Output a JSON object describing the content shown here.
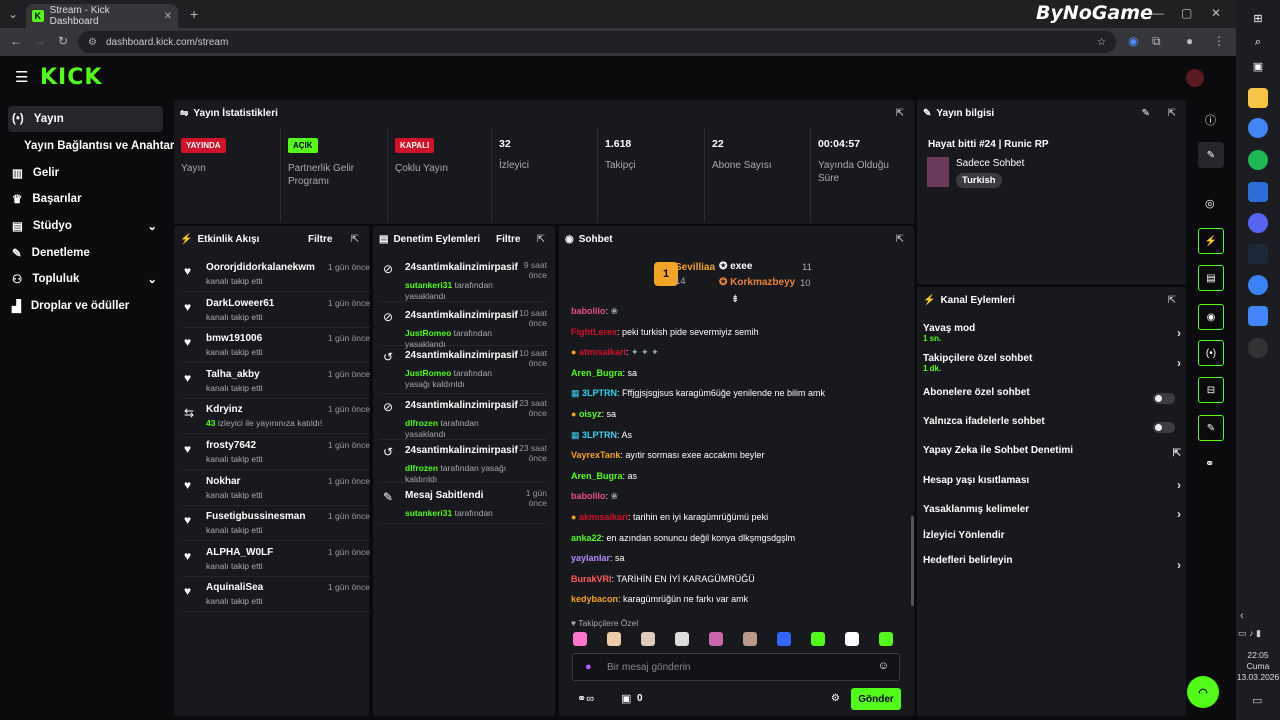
{
  "browser": {
    "tab_title": "Stream - Kick Dashboard",
    "url": "dashboard.kick.com/stream",
    "watermark": "ByNoGame"
  },
  "sidebar": {
    "items": [
      {
        "label": "Yayın",
        "icon": "broadcast-icon"
      },
      {
        "label": "Yayın Bağlantısı ve Anahtarı",
        "icon": ""
      },
      {
        "label": "Gelir",
        "icon": "chart-icon"
      },
      {
        "label": "Başarılar",
        "icon": "trophy-icon"
      },
      {
        "label": "Stüdyo",
        "icon": "studio-icon"
      },
      {
        "label": "Denetleme",
        "icon": "wrench-icon"
      },
      {
        "label": "Topluluk",
        "icon": "community-icon"
      },
      {
        "label": "Droplar ve ödüller",
        "icon": "drops-icon"
      }
    ]
  },
  "stats": {
    "title": "Yayın İstatistikleri",
    "items": [
      {
        "badge": "YAYINDA",
        "badge_color": "#d1102a",
        "label": "Yayın"
      },
      {
        "badge": "AÇIK",
        "badge_color": "#53fc18",
        "label": "Partnerlik Gelir Programı"
      },
      {
        "badge": "KAPALI",
        "badge_color": "#d1102a",
        "label": "Çoklu Yayın"
      },
      {
        "value": "32",
        "label": "İzleyici"
      },
      {
        "value": "1.618",
        "label": "Takipçi"
      },
      {
        "value": "22",
        "label": "Abone Sayısı"
      },
      {
        "value": "00:04:57",
        "label": "Yayında Olduğu Süre"
      }
    ]
  },
  "info": {
    "title": "Yayın bilgisi",
    "stream_title": "Hayat bitti #24 | Runic RP",
    "category": "Sadece Sohbet",
    "tag": "Turkish"
  },
  "activity": {
    "title": "Etkinlik Akışı",
    "filter": "Filtre",
    "items": [
      {
        "name": "Oororjdidorkalanekwm",
        "sub": "kanalı takip etti",
        "time": "1 gün önce"
      },
      {
        "name": "DarkLoweer61",
        "sub": "kanalı takip etti",
        "time": "1 gün önce"
      },
      {
        "name": "bmw191006",
        "sub": "kanalı takip etti",
        "time": "1 gün önce"
      },
      {
        "name": "Talha_akby",
        "sub": "kanalı takip etti",
        "time": "1 gün önce"
      },
      {
        "name": "Kdryinz",
        "sub_count": "43",
        "sub": "izleyici ile yayınınıza katıldı!",
        "time": "1 gün önce"
      },
      {
        "name": "frosty7642",
        "sub": "kanalı takip etti",
        "time": "1 gün önce"
      },
      {
        "name": "Nokhar",
        "sub": "kanalı takip etti",
        "time": "1 gün önce"
      },
      {
        "name": "Fusetigbussinesman",
        "sub": "kanalı takip etti",
        "time": "1 gün önce"
      },
      {
        "name": "ALPHA_W0LF",
        "sub": "kanalı takip etti",
        "time": "1 gün önce"
      },
      {
        "name": "AquinaliSea",
        "sub": "kanalı takip etti",
        "time": "1 gün önce"
      }
    ]
  },
  "moderation": {
    "title": "Denetim Eylemleri",
    "filter": "Filtre",
    "items": [
      {
        "name": "24santimkalinzimirpasif",
        "by": "sutankeri31",
        "sub": "tarafından yasaklandı",
        "time": "9 saat önce"
      },
      {
        "name": "24santimkalinzimirpasif",
        "by": "JustRomeo",
        "sub": "tarafından yasaklandı",
        "time": "10 saat önce"
      },
      {
        "name": "24santimkalinzimirpasif",
        "by": "JustRomeo",
        "sub": "tarafından yasağı kaldırıldı",
        "time": "10 saat önce"
      },
      {
        "name": "24santimkalinzimirpasif",
        "by": "dlfrozen",
        "sub": "tarafından yasaklandı",
        "time": "23 saat önce"
      },
      {
        "name": "24santimkalinzimirpasif",
        "by": "dlfrozen",
        "sub": "tarafından yasağı kaldırıldı",
        "time": "23 saat önce"
      },
      {
        "name": "Mesaj Sabitlendi",
        "by": "sutankeri31",
        "sub": "tarafından",
        "time": "1 gün önce"
      }
    ]
  },
  "chat": {
    "title": "Sohbet",
    "leaders": [
      {
        "name": "Sevilliaa",
        "count": "14"
      },
      {
        "name": "exee",
        "count": "11"
      },
      {
        "name": "Korkmazbeyy",
        "count": "10"
      }
    ],
    "messages": [
      {
        "user": "babolilo",
        "color": "#e64b8b",
        "text": ""
      },
      {
        "user": "FightLerex",
        "color": "#d1102a",
        "text": "peki turkish pide severmiyiz semih"
      },
      {
        "user": "atmısaikari",
        "color": "#d1102a",
        "text": "",
        "badge": true
      },
      {
        "user": "Aren_Bugra",
        "color": "#53fc18",
        "text": "sa"
      },
      {
        "user": "3LPTRN",
        "color": "#3ad0f0",
        "text": "Fffjgjsjsgjsus karagüm6üğe yenilende ne bilim amk"
      },
      {
        "user": "oisyz",
        "color": "#53fc18",
        "text": "sa",
        "badge": true
      },
      {
        "user": "3LPTRN",
        "color": "#3ad0f0",
        "text": "As"
      },
      {
        "user": "VayrexTank",
        "color": "#f7a324",
        "text": "ayıtir sorması exee accakmı beyler"
      },
      {
        "user": "Aren_Bugra",
        "color": "#53fc18",
        "text": "as"
      },
      {
        "user": "babolilo",
        "color": "#e64b8b",
        "text": ""
      },
      {
        "user": "akmısaikari",
        "color": "#d1102a",
        "text": "tarihin en iyi karagümrüğümü peki",
        "badge": true
      },
      {
        "user": "anka22",
        "color": "#53fc18",
        "text": "en azından sonuncu değil konya dlkşmgsdgşlm"
      },
      {
        "user": "yaylanlar",
        "color": "#b58bff",
        "text": "sa"
      },
      {
        "user": "BurakVRI",
        "color": "#ff5a5a",
        "text": "TARİHİN EN İYİ KARAGÜMRÜĞÜ"
      },
      {
        "user": "kedybacon",
        "color": "#f7a324",
        "text": "karagümrüğün ne farkı var amk"
      }
    ],
    "emote_label": "Takipçilere Özel",
    "placeholder": "Bir mesaj gönderin",
    "points": "0",
    "send": "Gönder"
  },
  "channel_actions": {
    "title": "Kanal Eylemleri",
    "items": [
      {
        "label": "Yavaş mod",
        "sub": "1 sn.",
        "control": "chevron"
      },
      {
        "label": "Takipçilere özel sohbet",
        "sub": "1 dk.",
        "control": "chevron"
      },
      {
        "label": "Abonelere özel sohbet",
        "control": "toggle"
      },
      {
        "label": "Yalnızca ifadelerle sohbet",
        "control": "toggle"
      },
      {
        "label": "Yapay Zeka ile Sohbet Denetimi",
        "control": "external"
      },
      {
        "label": "Hesap yaşı kısıtlaması",
        "control": "chevron"
      },
      {
        "label": "Yasaklanmış kelimeler",
        "control": "chevron"
      },
      {
        "label": "İzleyici Yönlendir",
        "control": "none"
      },
      {
        "label": "Hedefleri belirleyin",
        "control": "chevron"
      }
    ]
  },
  "taskbar": {
    "time": "22:05",
    "day": "Cuma",
    "date": "13.03.2026"
  }
}
